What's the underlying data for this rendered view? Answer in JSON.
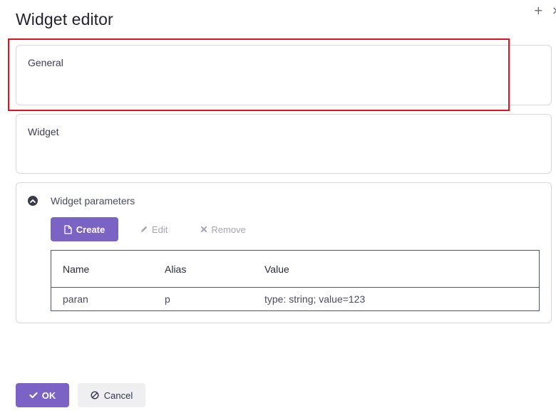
{
  "dialog": {
    "title": "Widget editor"
  },
  "window_controls": {
    "add_glyph": "+",
    "close_glyph": "×"
  },
  "sections": {
    "general_label": "General",
    "widget_label": "Widget",
    "params_label": "Widget parameters"
  },
  "toolbar": {
    "create_label": "Create",
    "edit_label": "Edit",
    "remove_label": "Remove"
  },
  "table": {
    "headers": [
      "Name",
      "Alias",
      "Value"
    ],
    "rows": [
      [
        "paran",
        "p",
        "type: string; value=123"
      ]
    ]
  },
  "footer": {
    "ok_label": "OK",
    "cancel_label": "Cancel"
  },
  "colors": {
    "accent": "#7a63c4",
    "highlight": "#e0141e",
    "disabled_text": "#a5a5b5",
    "border": "#d6d6de"
  },
  "icons": {
    "create": "file-icon",
    "edit": "pencil-icon",
    "remove": "x-icon",
    "ok": "check-icon",
    "cancel": "ban-icon",
    "collapse": "chevron-up-circle-icon"
  }
}
